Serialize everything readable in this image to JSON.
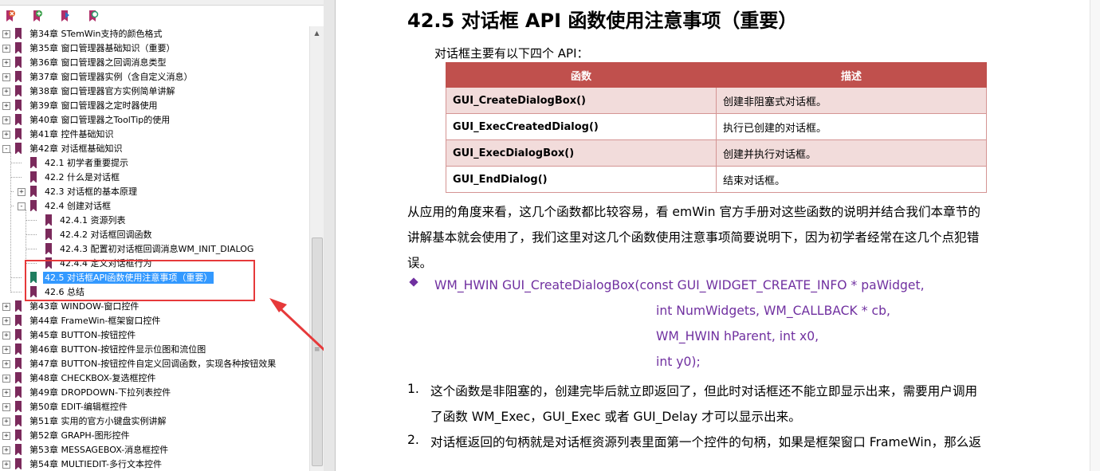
{
  "toolbar": {
    "icons": [
      "delete-bookmark-icon",
      "new-bookmark-icon",
      "expand-bookmark-icon",
      "find-bookmark-icon"
    ]
  },
  "tree": {
    "items": [
      {
        "label": "第34章 STemWin支持的颜色格式",
        "level": 0,
        "expander": "+"
      },
      {
        "label": "第35章 窗口管理器基础知识（重要）",
        "level": 0,
        "expander": "+"
      },
      {
        "label": "第36章 窗口管理器之回调消息类型",
        "level": 0,
        "expander": "+"
      },
      {
        "label": "第37章 窗口管理器实例（含自定义消息）",
        "level": 0,
        "expander": "+"
      },
      {
        "label": "第38章 窗口管理器官方实例简单讲解",
        "level": 0,
        "expander": "+"
      },
      {
        "label": "第39章 窗口管理器之定时器使用",
        "level": 0,
        "expander": "+"
      },
      {
        "label": "第40章 窗口管理器之ToolTip的使用",
        "level": 0,
        "expander": "+"
      },
      {
        "label": "第41章 控件基础知识",
        "level": 0,
        "expander": "+"
      },
      {
        "label": "第42章 对话框基础知识",
        "level": 0,
        "expander": "-"
      },
      {
        "label": "42.1 初学者重要提示",
        "level": 1,
        "expander": ""
      },
      {
        "label": "42.2 什么是对话框",
        "level": 1,
        "expander": ""
      },
      {
        "label": "42.3 对话框的基本原理",
        "level": 1,
        "expander": "+"
      },
      {
        "label": "42.4 创建对话框",
        "level": 1,
        "expander": "-"
      },
      {
        "label": "42.4.1 资源列表",
        "level": 2,
        "expander": ""
      },
      {
        "label": "42.4.2 对话框回调函数",
        "level": 2,
        "expander": ""
      },
      {
        "label": "42.4.3 配置初对话框回调消息WM_INIT_DIALOG",
        "level": 2,
        "expander": ""
      },
      {
        "label": "42.4.4 定义对话框行为",
        "level": 2,
        "expander": ""
      },
      {
        "label": "42.5 对话框API函数使用注意事项（重要）",
        "level": 1,
        "expander": "",
        "selected": true
      },
      {
        "label": "42.6 总结",
        "level": 1,
        "expander": ""
      },
      {
        "label": "第43章 WINDOW-窗口控件",
        "level": 0,
        "expander": "+"
      },
      {
        "label": "第44章 FrameWin-框架窗口控件",
        "level": 0,
        "expander": "+"
      },
      {
        "label": "第45章 BUTTON-按钮控件",
        "level": 0,
        "expander": "+"
      },
      {
        "label": "第46章 BUTTON-按钮控件显示位图和流位图",
        "level": 0,
        "expander": "+"
      },
      {
        "label": "第47章 BUTTON-按钮控件自定义回调函数，实现各种按钮效果",
        "level": 0,
        "expander": "+"
      },
      {
        "label": "第48章 CHECKBOX-复选框控件",
        "level": 0,
        "expander": "+"
      },
      {
        "label": "第49章 DROPDOWN-下拉列表控件",
        "level": 0,
        "expander": "+"
      },
      {
        "label": "第50章 EDIT-编辑框控件",
        "level": 0,
        "expander": "+"
      },
      {
        "label": "第51章 实用的官方小键盘实例讲解",
        "level": 0,
        "expander": "+"
      },
      {
        "label": "第52章 GRAPH-图形控件",
        "level": 0,
        "expander": "+"
      },
      {
        "label": "第53章 MESSAGEBOX-消息框控件",
        "level": 0,
        "expander": "+"
      },
      {
        "label": "第54章 MULTIEDIT-多行文本控件",
        "level": 0,
        "expander": "+"
      }
    ]
  },
  "colors": {
    "annotation": "#e6393a",
    "selection": "#3399ff",
    "table_header": "#c0504d",
    "table_shade": "#f2dcdb",
    "function_text": "#7030a0",
    "bookmark": "#7b2a5c"
  },
  "document": {
    "title": "42.5 对话框 API 函数使用注意事项（重要）",
    "intro": "对话框主要有以下四个 API：",
    "table": {
      "headers": [
        "函数",
        "描述"
      ],
      "rows": [
        [
          "GUI_CreateDialogBox()",
          "创建非阻塞式对话框。"
        ],
        [
          "GUI_ExecCreatedDialog()",
          "执行已创建的对话框。"
        ],
        [
          "GUI_ExecDialogBox()",
          "创建并执行对话框。"
        ],
        [
          "GUI_EndDialog()",
          "结束对话框。"
        ]
      ]
    },
    "para1": [
      "从应用的角度来看，这几个函数都比较容易，看 emWin 官方手册对这些函数的说明并结合我们本章节的",
      "讲解基本就会使用了，我们这里对这几个函数使用注意事项简要说明下，因为初学者经常在这几个点犯错",
      "误。"
    ],
    "func_lines": [
      "WM_HWIN GUI_CreateDialogBox(const GUI_WIDGET_CREATE_INFO * paWidget,",
      "int NumWidgets, WM_CALLBACK * cb,",
      "WM_HWIN hParent, int x0,",
      "int y0);"
    ],
    "list": [
      {
        "num": "1.",
        "lines": [
          "这个函数是非阻塞的，创建完毕后就立即返回了，但此时对话框还不能立即显示出来，需要用户调用",
          "了函数 WM_Exec，GUI_Exec 或者 GUI_Delay 才可以显示出来。"
        ]
      },
      {
        "num": "2.",
        "lines": [
          "对话框返回的句柄就是对话框资源列表里面第一个控件的句柄，如果是框架窗口 FrameWin，那么返"
        ]
      }
    ]
  }
}
